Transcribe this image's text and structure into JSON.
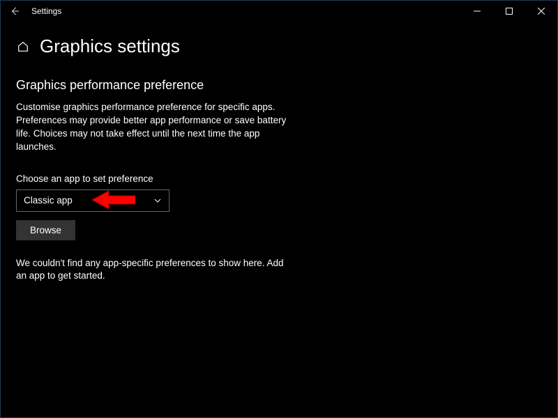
{
  "window": {
    "title": "Settings"
  },
  "page": {
    "title": "Graphics settings"
  },
  "section": {
    "title": "Graphics performance preference",
    "description": "Customise graphics performance preference for specific apps. Preferences may provide better app performance or save battery life. Choices may not take effect until the next time the app launches."
  },
  "appSelector": {
    "label": "Choose an app to set preference",
    "selected": "Classic app",
    "browseLabel": "Browse"
  },
  "emptyState": {
    "message": "We couldn't find any app-specific preferences to show here. Add an app to get started."
  }
}
